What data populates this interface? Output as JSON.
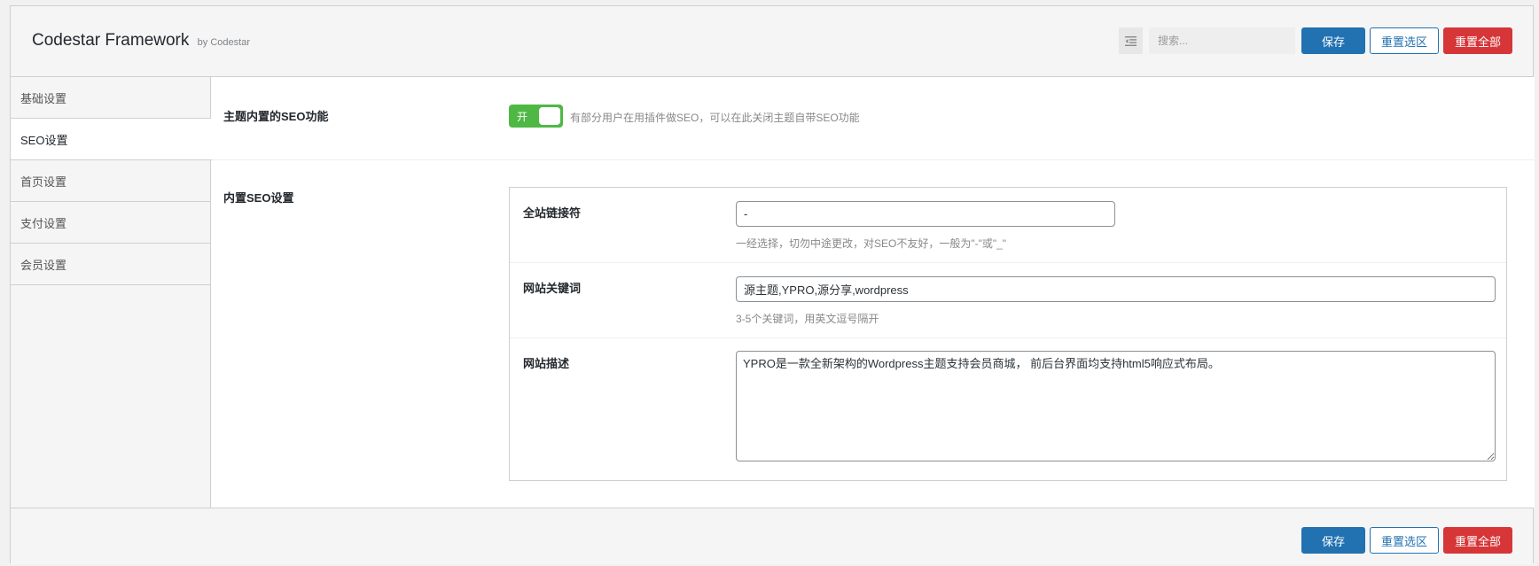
{
  "header": {
    "title": "Codestar Framework",
    "subtitle": "by Codestar",
    "search_placeholder": "搜索...",
    "save_label": "保存",
    "reset_section_label": "重置选区",
    "reset_all_label": "重置全部"
  },
  "sidebar": {
    "items": [
      {
        "label": "基础设置",
        "active": false
      },
      {
        "label": "SEO设置",
        "active": true
      },
      {
        "label": "首页设置",
        "active": false
      },
      {
        "label": "支付设置",
        "active": false
      },
      {
        "label": "会员设置",
        "active": false
      }
    ]
  },
  "fields": {
    "seo_toggle": {
      "title": "主题内置的SEO功能",
      "toggle_label": "开",
      "enabled": true,
      "description": "有部分用户在用插件做SEO，可以在此关闭主题自带SEO功能"
    },
    "builtin_seo": {
      "title": "内置SEO设置",
      "separator": {
        "title": "全站链接符",
        "value": "-",
        "description": "一经选择，切勿中途更改，对SEO不友好，一般为\"-\"或\"_\""
      },
      "keywords": {
        "title": "网站关键词",
        "value": "源主题,YPRO,源分享,wordpress",
        "description": "3-5个关键词，用英文逗号隔开"
      },
      "site_description": {
        "title": "网站描述",
        "value": "YPRO是一款全新架构的Wordpress主题支持会员商城， 前后台界面均支持html5响应式布局。"
      }
    }
  },
  "footer": {
    "save_label": "保存",
    "reset_section_label": "重置选区",
    "reset_all_label": "重置全部"
  },
  "colors": {
    "primary": "#2271b1",
    "danger": "#d63638",
    "toggle_on": "#4fb845"
  }
}
